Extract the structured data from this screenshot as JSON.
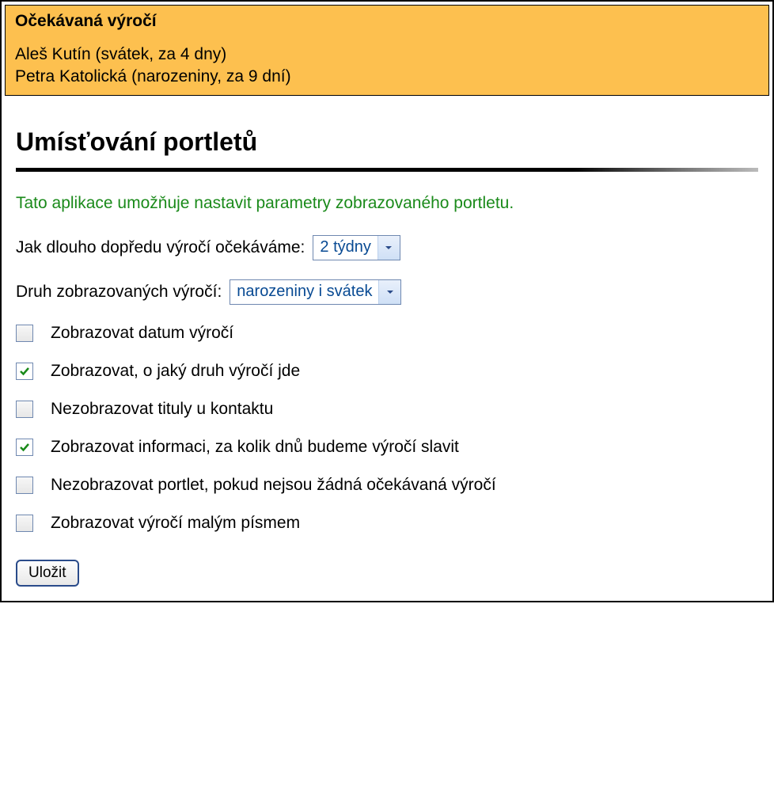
{
  "banner": {
    "title": "Očekávaná výročí",
    "entries": [
      "Aleš Kutín (svátek, za 4 dny)",
      "Petra Katolická (narozeniny, za 9 dní)"
    ]
  },
  "page_title": "Umísťování portletů",
  "description": "Tato aplikace umožňuje nastavit parametry zobrazovaného portletu.",
  "field_lookahead": {
    "label": "Jak dlouho dopředu výročí očekáváme:",
    "selected": "2 týdny"
  },
  "field_type": {
    "label": "Druh zobrazovaných výročí:",
    "selected": "narozeniny i svátek"
  },
  "checkboxes": [
    {
      "label": "Zobrazovat datum výročí",
      "checked": false
    },
    {
      "label": "Zobrazovat, o jaký druh výročí jde",
      "checked": true
    },
    {
      "label": "Nezobrazovat tituly u kontaktu",
      "checked": false
    },
    {
      "label": "Zobrazovat informaci, za kolik dnů budeme výročí slavit",
      "checked": true
    },
    {
      "label": "Nezobrazovat portlet, pokud nejsou žádná očekávaná výročí",
      "checked": false
    },
    {
      "label": "Zobrazovat výročí malým písmem",
      "checked": false
    }
  ],
  "save_button": "Uložit"
}
